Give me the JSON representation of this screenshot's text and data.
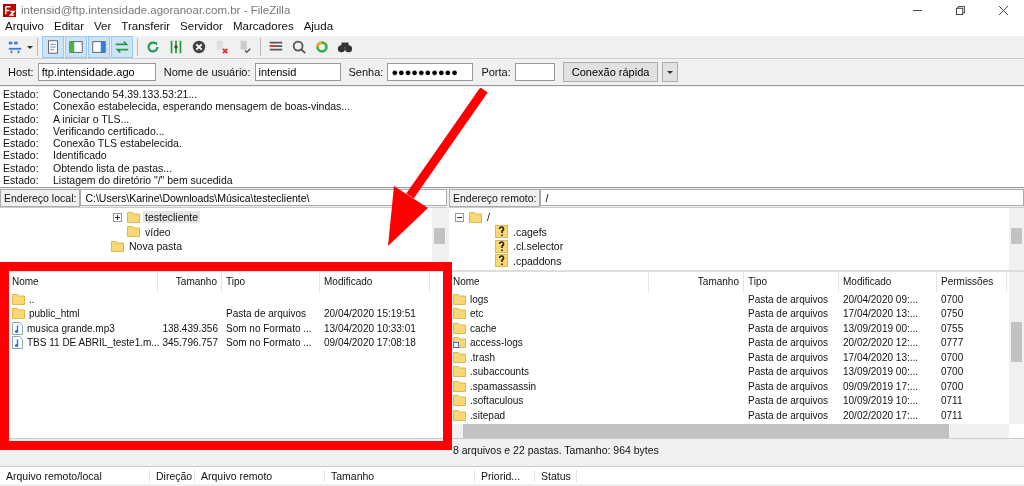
{
  "window": {
    "title": "intensid@ftp.intensidade.agoranoar.com.br - FileZilla"
  },
  "menu": [
    "Arquivo",
    "Editar",
    "Ver",
    "Transferir",
    "Servidor",
    "Marcadores",
    "Ajuda"
  ],
  "toolbar": [
    {
      "kind": "sitemanager",
      "selected": false
    },
    {
      "kind": "log",
      "selected": true
    },
    {
      "kind": "localtree",
      "selected": true
    },
    {
      "kind": "remotetree",
      "selected": true
    },
    {
      "kind": "queue",
      "selected": true
    },
    {
      "kind": "refresh",
      "selected": false
    },
    {
      "kind": "filter",
      "selected": false
    },
    {
      "kind": "cancel",
      "selected": false
    },
    {
      "kind": "disconnect",
      "selected": false
    },
    {
      "kind": "reconnect",
      "selected": false
    },
    {
      "kind": "dirlist",
      "selected": false
    },
    {
      "kind": "search",
      "selected": false
    },
    {
      "kind": "sync",
      "selected": false
    },
    {
      "kind": "find",
      "selected": false
    }
  ],
  "quickconnect": {
    "host_label": "Host:",
    "host": "ftp.intensidade.ago",
    "user_label": "Nome de usuário:",
    "user": "intensid",
    "pass_label": "Senha:",
    "password": "●●●●●●●●●●",
    "port_label": "Porta:",
    "button": "Conexão rápida"
  },
  "log": [
    {
      "label": "Estado:",
      "message": "Conectando 54.39.133.53:21..."
    },
    {
      "label": "Estado:",
      "message": "Conexão estabelecida, esperando mensagem de boas-vindas..."
    },
    {
      "label": "Estado:",
      "message": "A iniciar o TLS..."
    },
    {
      "label": "Estado:",
      "message": "Verificando certificado..."
    },
    {
      "label": "Estado:",
      "message": "Conexão TLS estabelecida."
    },
    {
      "label": "Estado:",
      "message": "Identificado"
    },
    {
      "label": "Estado:",
      "message": "Obtendo lista de pastas..."
    },
    {
      "label": "Estado:",
      "message": "Listagem do diretório \"/\" bem sucedida"
    }
  ],
  "local": {
    "address_label": "Endereço local:",
    "address": "C:\\Users\\Karine\\Downloads\\Música\\testecliente\\",
    "tree": [
      {
        "children": [
          {
            "label": "testecliente",
            "kind": "folder",
            "selected": true,
            "expanded": false
          },
          {
            "label": "vídeo",
            "kind": "folder",
            "selected": false
          }
        ]
      },
      {
        "label": "Nova pasta",
        "kind": "folder",
        "selected": false
      }
    ],
    "columns": [
      "Nome",
      "Tamanho",
      "Tipo",
      "Modificado"
    ],
    "rows": [
      {
        "kind": "folder",
        "cells": [
          "..",
          "",
          "",
          ""
        ]
      },
      {
        "kind": "folder",
        "cells": [
          "public_html",
          "",
          "Pasta de arquivos",
          "20/04/2020 15:19:51"
        ]
      },
      {
        "kind": "audio",
        "cells": [
          "musica grande.mp3",
          "138.439.356",
          "Som no Formato ...",
          "13/04/2020 10:33:01"
        ]
      },
      {
        "kind": "audio",
        "cells": [
          "TBS 11 DE ABRIL_teste1.m...",
          "345.796.757",
          "Som no Formato ...",
          "09/04/2020 17:08:18"
        ]
      }
    ]
  },
  "remote": {
    "address_label": "Endereço remoto:",
    "address": "/",
    "tree": [
      {
        "label": "/",
        "kind": "folder",
        "selected": false,
        "expanded": true,
        "children": [
          {
            "label": ".cagefs",
            "kind": "unknown",
            "selected": false
          },
          {
            "label": ".cl.selector",
            "kind": "unknown",
            "selected": false
          },
          {
            "label": ".cpaddons",
            "kind": "unknown",
            "selected": false
          }
        ]
      }
    ],
    "columns": [
      "Nome",
      "Tamanho",
      "Tipo",
      "Modificado",
      "Permissões"
    ],
    "rows": [
      {
        "kind": "folder",
        "cells": [
          "logs",
          "",
          "Pasta de arquivos",
          "20/04/2020 09:...",
          "0700"
        ]
      },
      {
        "kind": "folder",
        "cells": [
          "etc",
          "",
          "Pasta de arquivos",
          "17/04/2020 13:...",
          "0750"
        ]
      },
      {
        "kind": "folder",
        "cells": [
          "cache",
          "",
          "Pasta de arquivos",
          "13/09/2019 00:...",
          "0755"
        ]
      },
      {
        "kind": "link",
        "cells": [
          "access-logs",
          "",
          "Pasta de arquivos",
          "20/02/2020 12:...",
          "0777"
        ]
      },
      {
        "kind": "folder",
        "cells": [
          ".trash",
          "",
          "Pasta de arquivos",
          "17/04/2020 13:...",
          "0700"
        ]
      },
      {
        "kind": "folder",
        "cells": [
          ".subaccounts",
          "",
          "Pasta de arquivos",
          "13/09/2019 00:...",
          "0700"
        ]
      },
      {
        "kind": "folder",
        "cells": [
          ".spamassassin",
          "",
          "Pasta de arquivos",
          "09/09/2019 17:...",
          "0700"
        ]
      },
      {
        "kind": "folder",
        "cells": [
          ".softaculous",
          "",
          "Pasta de arquivos",
          "10/09/2019 10:...",
          "0711"
        ]
      },
      {
        "kind": "folder",
        "cells": [
          ".sitepad",
          "",
          "Pasta de arquivos",
          "20/02/2020 17:...",
          "0711"
        ]
      }
    ],
    "status": "8 arquivos e 22 pastas. Tamanho: 964 bytes"
  },
  "queue": {
    "columns": [
      "Arquivo remoto/local",
      "Direção",
      "Arquivo remoto",
      "Tamanho",
      "Priorid...",
      "Status"
    ]
  }
}
